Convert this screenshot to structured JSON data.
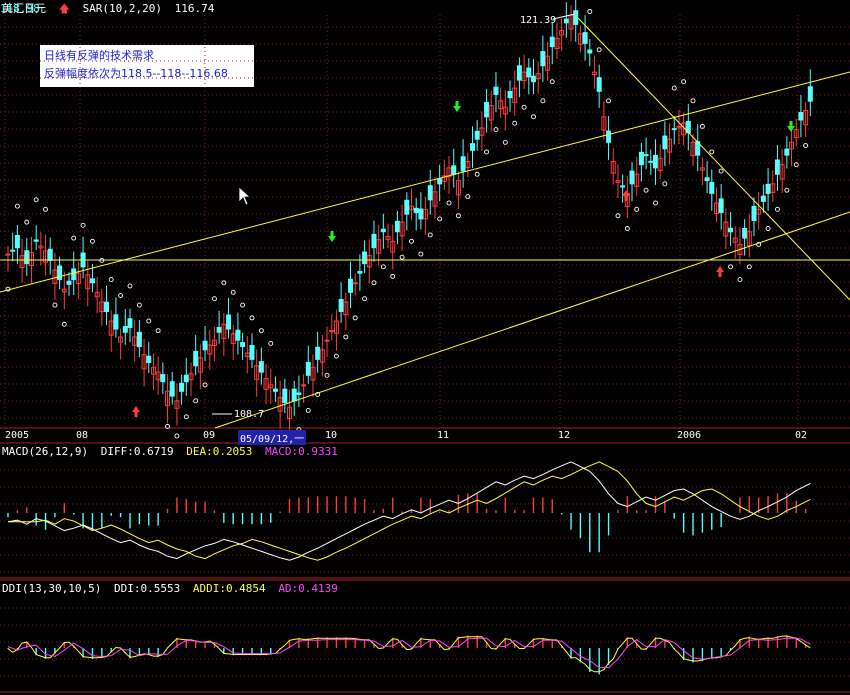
{
  "header": {
    "symbol": "美汇日元",
    "indicator": "SAR(10,2,20)",
    "indicator_value": "116.74",
    "last_price": "118.98"
  },
  "annotation": {
    "line1": "日线有反弹的技术需求",
    "line2": "反弹幅度依次为118.5--118--116.68"
  },
  "labels": {
    "high": "121.39",
    "low": "108.7"
  },
  "x_axis": {
    "ticks": [
      "2005",
      "08",
      "09",
      "10",
      "11",
      "12",
      "2006",
      "02"
    ],
    "selected": "05/09/12,一"
  },
  "macd": {
    "label": "MACD(26,12,9)",
    "diff": "DIFF:0.6719",
    "dea": "DEA:0.2053",
    "macd": "MACD:0.9331"
  },
  "ddi": {
    "label": "DDI(13,30,10,5)",
    "ddi": "DDI:0.5553",
    "addi": "ADDI:0.4854",
    "ad": "AD:0.4139"
  },
  "colors": {
    "up": "#ff3c3c",
    "down": "#54ffff",
    "yellow": "#ffff44",
    "white": "#ffffff",
    "magenta": "#ff44ff",
    "grid": "#8b1a1a"
  },
  "chart_data": {
    "type": "candlestick",
    "price_range": [
      108.7,
      121.39
    ],
    "close_path": [
      113.9,
      114.1,
      113.6,
      114.3,
      114.0,
      113.4,
      112.8,
      113.1,
      113.5,
      113.0,
      112.4,
      111.8,
      111.3,
      111.6,
      111.0,
      110.5,
      110.2,
      109.6,
      109.3,
      109.9,
      110.4,
      110.9,
      111.2,
      111.7,
      111.4,
      111.0,
      110.6,
      110.2,
      109.8,
      109.4,
      109.1,
      109.5,
      110.1,
      110.6,
      111.2,
      111.8,
      112.4,
      113.0,
      113.6,
      114.1,
      114.6,
      114.3,
      114.9,
      115.4,
      115.0,
      115.6,
      116.1,
      116.6,
      116.2,
      116.8,
      117.5,
      118.2,
      118.9,
      118.5,
      119.1,
      119.6,
      119.3,
      119.8,
      120.4,
      120.9,
      121.39,
      120.8,
      120.2,
      119.0,
      117.4,
      116.2,
      115.8,
      116.4,
      117.0,
      116.6,
      117.2,
      117.8,
      118.0,
      117.4,
      116.6,
      115.8,
      115.2,
      114.6,
      114.2,
      114.6,
      115.3,
      115.8,
      116.4,
      117.0,
      117.8,
      118.4,
      118.98
    ],
    "buy_arrows": [
      "08",
      "2006 early"
    ],
    "sell_arrows": [
      "10",
      "11",
      "2006"
    ]
  }
}
